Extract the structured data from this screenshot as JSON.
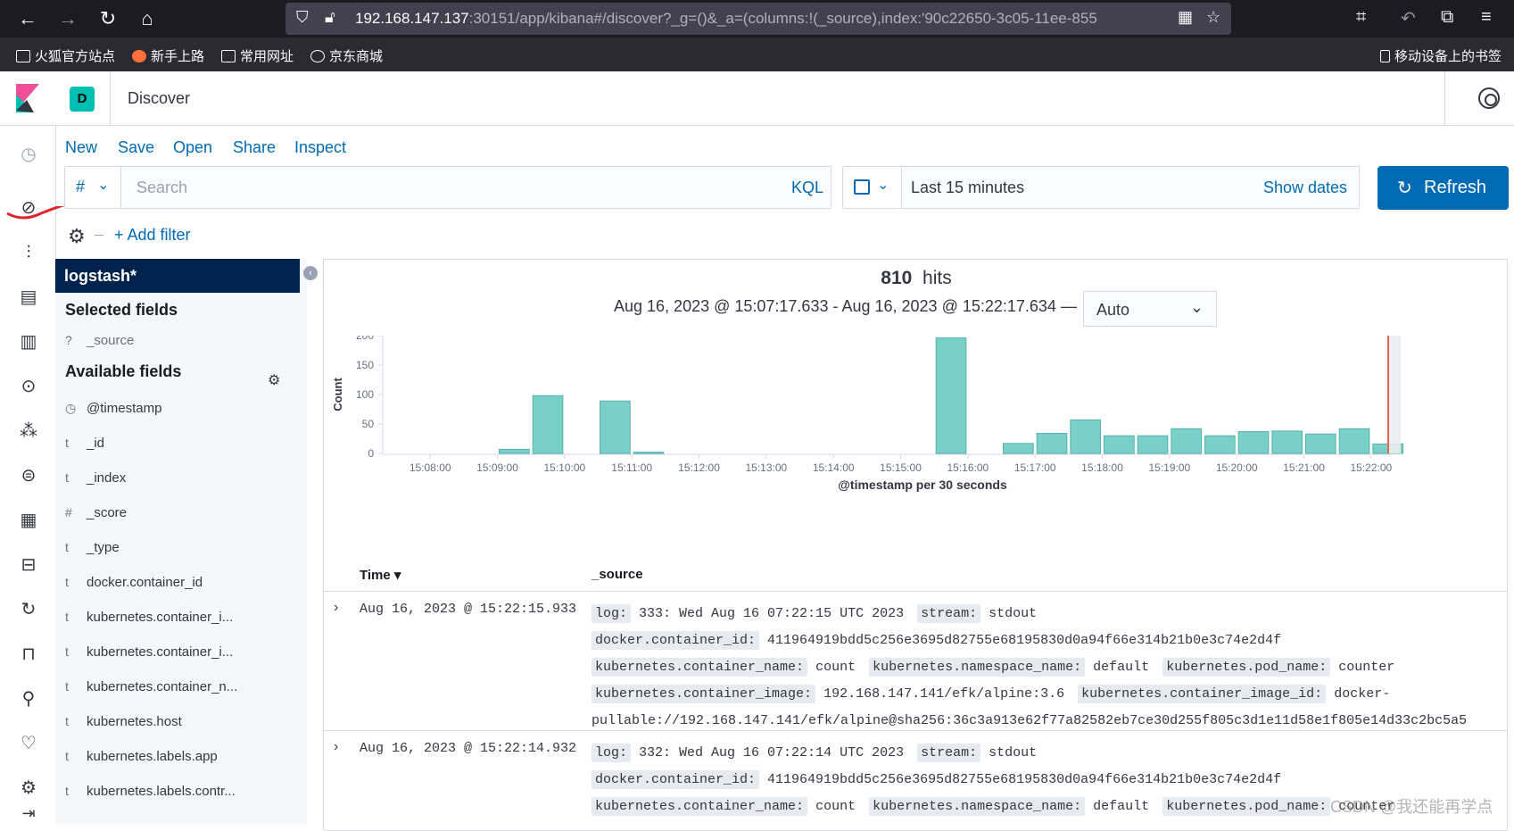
{
  "browser": {
    "url_host": "192.168.147.137",
    "url_rest": ":30151/app/kibana#/discover?_g=()&_a=(columns:!(_source),index:'90c22650-3c05-11ee-855",
    "bookmarks": [
      "火狐官方站点",
      "新手上路",
      "常用网址",
      "京东商城"
    ],
    "mobile_bookmarks": "移动设备上的书签"
  },
  "header": {
    "space_initial": "D",
    "title": "Discover"
  },
  "topmenu": {
    "new": "New",
    "save": "Save",
    "open": "Open",
    "share": "Share",
    "inspect": "Inspect"
  },
  "query": {
    "language_symbol": "#",
    "placeholder": "Search",
    "language": "KQL"
  },
  "datepicker": {
    "range": "Last 15 minutes",
    "show_dates": "Show dates",
    "refresh": "Refresh"
  },
  "filter": {
    "add_filter": "+ Add filter"
  },
  "sidebar": {
    "index_pattern": "logstash*",
    "selected_heading": "Selected fields",
    "selected_fields": [
      {
        "type": "?",
        "name": "_source"
      }
    ],
    "available_heading": "Available fields",
    "available_fields": [
      {
        "type": "◷",
        "name": "@timestamp"
      },
      {
        "type": "t",
        "name": "_id"
      },
      {
        "type": "t",
        "name": "_index"
      },
      {
        "type": "#",
        "name": "_score"
      },
      {
        "type": "t",
        "name": "_type"
      },
      {
        "type": "t",
        "name": "docker.container_id"
      },
      {
        "type": "t",
        "name": "kubernetes.container_i..."
      },
      {
        "type": "t",
        "name": "kubernetes.container_i..."
      },
      {
        "type": "t",
        "name": "kubernetes.container_n..."
      },
      {
        "type": "t",
        "name": "kubernetes.host"
      },
      {
        "type": "t",
        "name": "kubernetes.labels.app"
      },
      {
        "type": "t",
        "name": "kubernetes.labels.contr..."
      }
    ]
  },
  "results": {
    "hits": "810",
    "hits_label": "hits",
    "range_text": "Aug 16, 2023 @ 15:07:17.633 - Aug 16, 2023 @ 15:22:17.634 —",
    "interval": "Auto",
    "columns": {
      "time": "Time",
      "source": "_source"
    },
    "rows": [
      {
        "time": "Aug 16, 2023 @ 15:22:15.933",
        "fields": [
          {
            "k": "log:",
            "v": "333: Wed Aug 16 07:22:15 UTC 2023"
          },
          {
            "k": "stream:",
            "v": "stdout"
          },
          {
            "k": "docker.container_id:",
            "v": "411964919bdd5c256e3695d82755e68195830d0a94f66e314b21b0e3c74e2d4f"
          },
          {
            "k": "kubernetes.container_name:",
            "v": "count"
          },
          {
            "k": "kubernetes.namespace_name:",
            "v": "default"
          },
          {
            "k": "kubernetes.pod_name:",
            "v": "counter"
          },
          {
            "k": "kubernetes.container_image:",
            "v": "192.168.147.141/efk/alpine:3.6"
          },
          {
            "k": "kubernetes.container_image_id:",
            "v": "docker-pullable://192.168.147.141/efk/alpine@sha256:36c3a913e62f77a82582eb7ce30d255f805c3d1e11d58e1f805e14d33c2bc5a5"
          }
        ]
      },
      {
        "time": "Aug 16, 2023 @ 15:22:14.932",
        "fields": [
          {
            "k": "log:",
            "v": "332: Wed Aug 16 07:22:14 UTC 2023"
          },
          {
            "k": "stream:",
            "v": "stdout"
          },
          {
            "k": "docker.container_id:",
            "v": "411964919bdd5c256e3695d82755e68195830d0a94f66e314b21b0e3c74e2d4f"
          },
          {
            "k": "kubernetes.container_name:",
            "v": "count"
          },
          {
            "k": "kubernetes.namespace_name:",
            "v": "default"
          },
          {
            "k": "kubernetes.pod_name:",
            "v": "counter"
          }
        ]
      }
    ]
  },
  "chart_data": {
    "type": "bar",
    "ylabel": "Count",
    "xlabel": "@timestamp per 30 seconds",
    "ylim": [
      0,
      200
    ],
    "yticks": [
      0,
      50,
      100,
      150,
      200
    ],
    "xticks": [
      "15:08:00",
      "15:09:00",
      "15:10:00",
      "15:11:00",
      "15:12:00",
      "15:13:00",
      "15:14:00",
      "15:15:00",
      "15:16:00",
      "15:17:00",
      "15:18:00",
      "15:19:00",
      "15:20:00",
      "15:21:00",
      "15:22:00"
    ],
    "bar_color": "#7ad0c8",
    "bars": [
      {
        "t": "15:09:00",
        "value": 7
      },
      {
        "t": "15:09:30",
        "value": 98
      },
      {
        "t": "15:10:30",
        "value": 89
      },
      {
        "t": "15:11:00",
        "value": 2
      },
      {
        "t": "15:15:30",
        "value": 196
      },
      {
        "t": "15:16:30",
        "value": 17
      },
      {
        "t": "15:17:00",
        "value": 34
      },
      {
        "t": "15:17:30",
        "value": 57
      },
      {
        "t": "15:18:00",
        "value": 30
      },
      {
        "t": "15:18:30",
        "value": 30
      },
      {
        "t": "15:19:00",
        "value": 42
      },
      {
        "t": "15:19:30",
        "value": 30
      },
      {
        "t": "15:20:00",
        "value": 37
      },
      {
        "t": "15:20:30",
        "value": 38
      },
      {
        "t": "15:21:00",
        "value": 33
      },
      {
        "t": "15:21:30",
        "value": 42
      },
      {
        "t": "15:22:00",
        "value": 16
      }
    ],
    "now_marker_color": "#e7664c"
  },
  "watermark": "CSDN @我还能再学点"
}
